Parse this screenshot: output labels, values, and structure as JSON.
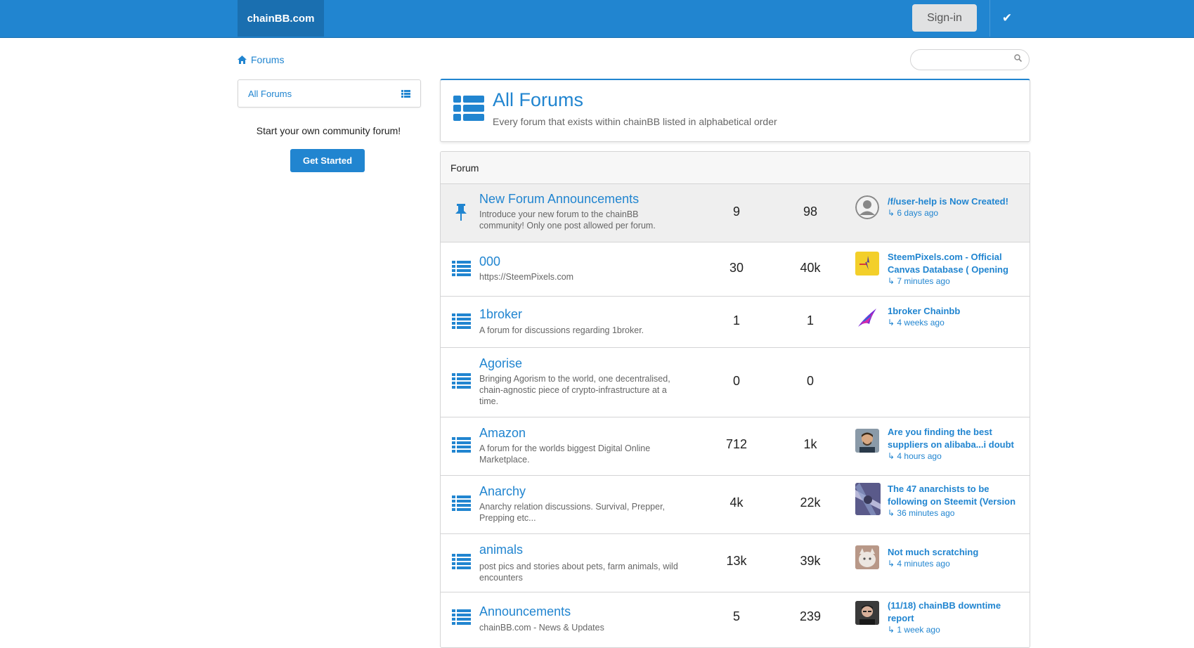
{
  "topbar": {
    "brand": "chainBB.com",
    "signin": "Sign-in"
  },
  "breadcrumb": {
    "label": "Forums"
  },
  "sidebar": {
    "menu_label": "All Forums",
    "promo": "Start your own community forum!",
    "cta": "Get Started"
  },
  "header": {
    "title": "All Forums",
    "subtitle": "Every forum that exists within chainBB listed in alphabetical order"
  },
  "table": {
    "column_header": "Forum",
    "rows": [
      {
        "name": "New Forum Announcements",
        "desc": "Introduce your new forum to the chainBB community! Only one post allowed per forum.",
        "topics": "9",
        "posts": "98",
        "last_title": "/f/user-help is Now Created!",
        "last_time": "↳ 6 days ago",
        "icon": "pin-icon"
      },
      {
        "name": "000",
        "desc": "https://SteemPixels.com",
        "topics": "30",
        "posts": "40k",
        "last_title": "SteemPixels.com - Official Canvas Database ( Opening",
        "last_time": "↳ 7 minutes ago",
        "icon": "list-icon"
      },
      {
        "name": "1broker",
        "desc": "A forum for discussions regarding 1broker.",
        "topics": "1",
        "posts": "1",
        "last_title": "1broker Chainbb",
        "last_time": "↳ 4 weeks ago",
        "icon": "list-icon"
      },
      {
        "name": "Agorise",
        "desc": "Bringing Agorism to the world, one decentralised, chain-agnostic piece of crypto-infrastructure at a time.",
        "topics": "0",
        "posts": "0",
        "last_title": "",
        "last_time": "",
        "icon": "list-icon"
      },
      {
        "name": "Amazon",
        "desc": "A forum for the worlds biggest Digital Online Marketplace.",
        "topics": "712",
        "posts": "1k",
        "last_title": "Are you finding the best suppliers on alibaba...i doubt",
        "last_time": "↳ 4 hours ago",
        "icon": "list-icon"
      },
      {
        "name": "Anarchy",
        "desc": "Anarchy relation discussions. Survival, Prepper, Prepping etc...",
        "topics": "4k",
        "posts": "22k",
        "last_title": "The 47 anarchists to be following on Steemit (Version",
        "last_time": "↳ 36 minutes ago",
        "icon": "list-icon"
      },
      {
        "name": "animals",
        "desc": "post pics and stories about pets, farm animals, wild encounters",
        "topics": "13k",
        "posts": "39k",
        "last_title": "Not much scratching",
        "last_time": "↳ 4 minutes ago",
        "icon": "list-icon"
      },
      {
        "name": "Announcements",
        "desc": "chainBB.com - News & Updates",
        "topics": "5",
        "posts": "239",
        "last_title": "(11/18) chainBB downtime report",
        "last_time": "↳ 1 week ago",
        "icon": "list-icon"
      }
    ]
  },
  "colors": {
    "accent": "#2185d0",
    "accent_dark": "#1a6fb0",
    "pinned_row": "#efefef"
  }
}
